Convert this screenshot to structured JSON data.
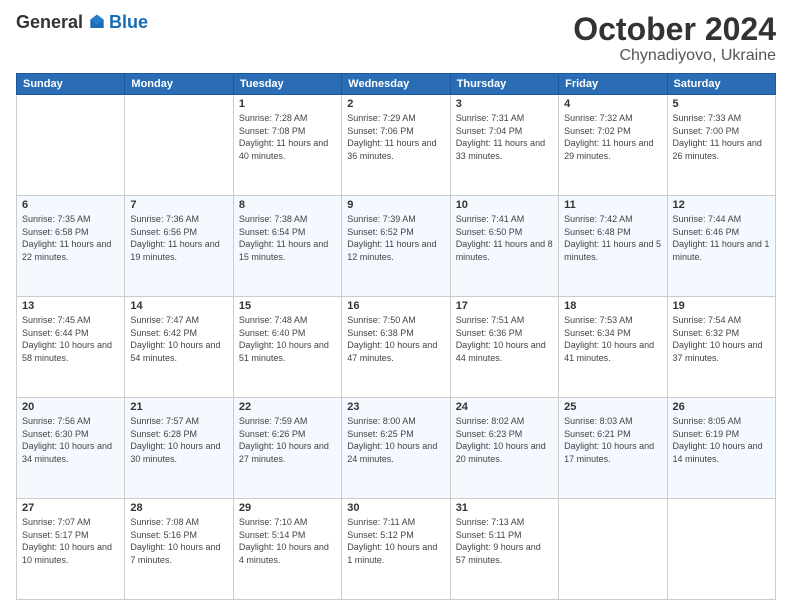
{
  "logo": {
    "general": "General",
    "blue": "Blue"
  },
  "title": {
    "month": "October 2024",
    "location": "Chynadiyovo, Ukraine"
  },
  "weekdays": [
    "Sunday",
    "Monday",
    "Tuesday",
    "Wednesday",
    "Thursday",
    "Friday",
    "Saturday"
  ],
  "weeks": [
    [
      {
        "day": "",
        "info": ""
      },
      {
        "day": "",
        "info": ""
      },
      {
        "day": "1",
        "info": "Sunrise: 7:28 AM\nSunset: 7:08 PM\nDaylight: 11 hours and 40 minutes."
      },
      {
        "day": "2",
        "info": "Sunrise: 7:29 AM\nSunset: 7:06 PM\nDaylight: 11 hours and 36 minutes."
      },
      {
        "day": "3",
        "info": "Sunrise: 7:31 AM\nSunset: 7:04 PM\nDaylight: 11 hours and 33 minutes."
      },
      {
        "day": "4",
        "info": "Sunrise: 7:32 AM\nSunset: 7:02 PM\nDaylight: 11 hours and 29 minutes."
      },
      {
        "day": "5",
        "info": "Sunrise: 7:33 AM\nSunset: 7:00 PM\nDaylight: 11 hours and 26 minutes."
      }
    ],
    [
      {
        "day": "6",
        "info": "Sunrise: 7:35 AM\nSunset: 6:58 PM\nDaylight: 11 hours and 22 minutes."
      },
      {
        "day": "7",
        "info": "Sunrise: 7:36 AM\nSunset: 6:56 PM\nDaylight: 11 hours and 19 minutes."
      },
      {
        "day": "8",
        "info": "Sunrise: 7:38 AM\nSunset: 6:54 PM\nDaylight: 11 hours and 15 minutes."
      },
      {
        "day": "9",
        "info": "Sunrise: 7:39 AM\nSunset: 6:52 PM\nDaylight: 11 hours and 12 minutes."
      },
      {
        "day": "10",
        "info": "Sunrise: 7:41 AM\nSunset: 6:50 PM\nDaylight: 11 hours and 8 minutes."
      },
      {
        "day": "11",
        "info": "Sunrise: 7:42 AM\nSunset: 6:48 PM\nDaylight: 11 hours and 5 minutes."
      },
      {
        "day": "12",
        "info": "Sunrise: 7:44 AM\nSunset: 6:46 PM\nDaylight: 11 hours and 1 minute."
      }
    ],
    [
      {
        "day": "13",
        "info": "Sunrise: 7:45 AM\nSunset: 6:44 PM\nDaylight: 10 hours and 58 minutes."
      },
      {
        "day": "14",
        "info": "Sunrise: 7:47 AM\nSunset: 6:42 PM\nDaylight: 10 hours and 54 minutes."
      },
      {
        "day": "15",
        "info": "Sunrise: 7:48 AM\nSunset: 6:40 PM\nDaylight: 10 hours and 51 minutes."
      },
      {
        "day": "16",
        "info": "Sunrise: 7:50 AM\nSunset: 6:38 PM\nDaylight: 10 hours and 47 minutes."
      },
      {
        "day": "17",
        "info": "Sunrise: 7:51 AM\nSunset: 6:36 PM\nDaylight: 10 hours and 44 minutes."
      },
      {
        "day": "18",
        "info": "Sunrise: 7:53 AM\nSunset: 6:34 PM\nDaylight: 10 hours and 41 minutes."
      },
      {
        "day": "19",
        "info": "Sunrise: 7:54 AM\nSunset: 6:32 PM\nDaylight: 10 hours and 37 minutes."
      }
    ],
    [
      {
        "day": "20",
        "info": "Sunrise: 7:56 AM\nSunset: 6:30 PM\nDaylight: 10 hours and 34 minutes."
      },
      {
        "day": "21",
        "info": "Sunrise: 7:57 AM\nSunset: 6:28 PM\nDaylight: 10 hours and 30 minutes."
      },
      {
        "day": "22",
        "info": "Sunrise: 7:59 AM\nSunset: 6:26 PM\nDaylight: 10 hours and 27 minutes."
      },
      {
        "day": "23",
        "info": "Sunrise: 8:00 AM\nSunset: 6:25 PM\nDaylight: 10 hours and 24 minutes."
      },
      {
        "day": "24",
        "info": "Sunrise: 8:02 AM\nSunset: 6:23 PM\nDaylight: 10 hours and 20 minutes."
      },
      {
        "day": "25",
        "info": "Sunrise: 8:03 AM\nSunset: 6:21 PM\nDaylight: 10 hours and 17 minutes."
      },
      {
        "day": "26",
        "info": "Sunrise: 8:05 AM\nSunset: 6:19 PM\nDaylight: 10 hours and 14 minutes."
      }
    ],
    [
      {
        "day": "27",
        "info": "Sunrise: 7:07 AM\nSunset: 5:17 PM\nDaylight: 10 hours and 10 minutes."
      },
      {
        "day": "28",
        "info": "Sunrise: 7:08 AM\nSunset: 5:16 PM\nDaylight: 10 hours and 7 minutes."
      },
      {
        "day": "29",
        "info": "Sunrise: 7:10 AM\nSunset: 5:14 PM\nDaylight: 10 hours and 4 minutes."
      },
      {
        "day": "30",
        "info": "Sunrise: 7:11 AM\nSunset: 5:12 PM\nDaylight: 10 hours and 1 minute."
      },
      {
        "day": "31",
        "info": "Sunrise: 7:13 AM\nSunset: 5:11 PM\nDaylight: 9 hours and 57 minutes."
      },
      {
        "day": "",
        "info": ""
      },
      {
        "day": "",
        "info": ""
      }
    ]
  ]
}
